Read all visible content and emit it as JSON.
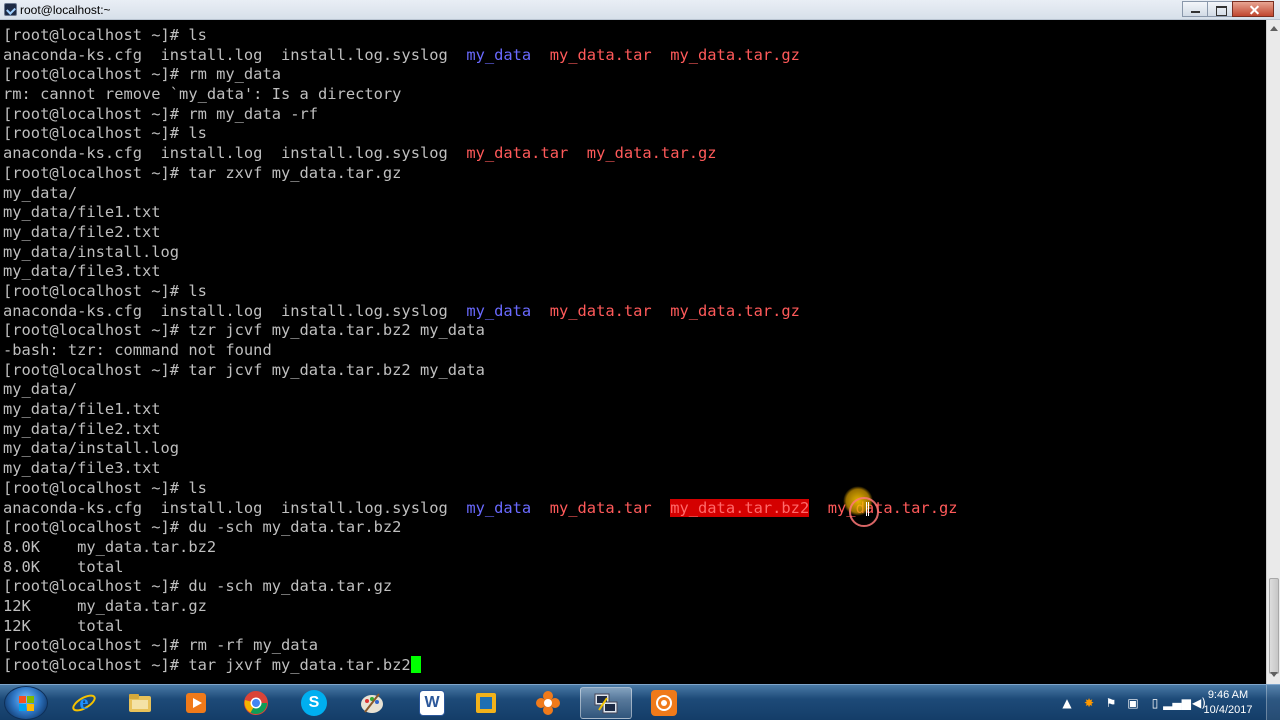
{
  "window": {
    "title": "root@localhost:~"
  },
  "terminal": {
    "lines": [
      [
        {
          "t": "[root@localhost ~]# ls",
          "c": ""
        }
      ],
      [
        {
          "t": "anaconda-ks.cfg  install.log  install.log.syslog  ",
          "c": ""
        },
        {
          "t": "my_data",
          "c": "dir"
        },
        {
          "t": "  ",
          "c": ""
        },
        {
          "t": "my_data.tar",
          "c": "arc"
        },
        {
          "t": "  ",
          "c": ""
        },
        {
          "t": "my_data.tar.gz",
          "c": "arc"
        }
      ],
      [
        {
          "t": "[root@localhost ~]# rm my_data",
          "c": ""
        }
      ],
      [
        {
          "t": "rm: cannot remove `my_data': Is a directory",
          "c": ""
        }
      ],
      [
        {
          "t": "[root@localhost ~]# rm my_data -rf",
          "c": ""
        }
      ],
      [
        {
          "t": "[root@localhost ~]# ls",
          "c": ""
        }
      ],
      [
        {
          "t": "anaconda-ks.cfg  install.log  install.log.syslog  ",
          "c": ""
        },
        {
          "t": "my_data.tar",
          "c": "arc"
        },
        {
          "t": "  ",
          "c": ""
        },
        {
          "t": "my_data.tar.gz",
          "c": "arc"
        }
      ],
      [
        {
          "t": "[root@localhost ~]# tar zxvf my_data.tar.gz",
          "c": ""
        }
      ],
      [
        {
          "t": "my_data/",
          "c": ""
        }
      ],
      [
        {
          "t": "my_data/file1.txt",
          "c": ""
        }
      ],
      [
        {
          "t": "my_data/file2.txt",
          "c": ""
        }
      ],
      [
        {
          "t": "my_data/install.log",
          "c": ""
        }
      ],
      [
        {
          "t": "my_data/file3.txt",
          "c": ""
        }
      ],
      [
        {
          "t": "[root@localhost ~]# ls",
          "c": ""
        }
      ],
      [
        {
          "t": "anaconda-ks.cfg  install.log  install.log.syslog  ",
          "c": ""
        },
        {
          "t": "my_data",
          "c": "dir"
        },
        {
          "t": "  ",
          "c": ""
        },
        {
          "t": "my_data.tar",
          "c": "arc"
        },
        {
          "t": "  ",
          "c": ""
        },
        {
          "t": "my_data.tar.gz",
          "c": "arc"
        }
      ],
      [
        {
          "t": "[root@localhost ~]# tzr jcvf my_data.tar.bz2 my_data",
          "c": ""
        }
      ],
      [
        {
          "t": "-bash: tzr: command not found",
          "c": ""
        }
      ],
      [
        {
          "t": "[root@localhost ~]# tar jcvf my_data.tar.bz2 my_data",
          "c": ""
        }
      ],
      [
        {
          "t": "my_data/",
          "c": ""
        }
      ],
      [
        {
          "t": "my_data/file1.txt",
          "c": ""
        }
      ],
      [
        {
          "t": "my_data/file2.txt",
          "c": ""
        }
      ],
      [
        {
          "t": "my_data/install.log",
          "c": ""
        }
      ],
      [
        {
          "t": "my_data/file3.txt",
          "c": ""
        }
      ],
      [
        {
          "t": "[root@localhost ~]# ls",
          "c": ""
        }
      ],
      [
        {
          "t": "anaconda-ks.cfg  install.log  install.log.syslog  ",
          "c": ""
        },
        {
          "t": "my_data",
          "c": "dir"
        },
        {
          "t": "  ",
          "c": ""
        },
        {
          "t": "my_data.tar",
          "c": "arc"
        },
        {
          "t": "  ",
          "c": ""
        },
        {
          "t": "my_data.tar.bz2",
          "c": "hl"
        },
        {
          "t": "  ",
          "c": ""
        },
        {
          "t": "my_data.tar.gz",
          "c": "arc"
        }
      ],
      [
        {
          "t": "[root@localhost ~]# du -sch my_data.tar.bz2",
          "c": ""
        }
      ],
      [
        {
          "t": "8.0K    my_data.tar.bz2",
          "c": ""
        }
      ],
      [
        {
          "t": "8.0K    total",
          "c": ""
        }
      ],
      [
        {
          "t": "[root@localhost ~]# du -sch my_data.tar.gz",
          "c": ""
        }
      ],
      [
        {
          "t": "12K     my_data.tar.gz",
          "c": ""
        }
      ],
      [
        {
          "t": "12K     total",
          "c": ""
        }
      ],
      [
        {
          "t": "[root@localhost ~]# rm -rf my_data",
          "c": ""
        }
      ],
      [
        {
          "t": "[root@localhost ~]# tar jxvf my_data.tar.bz2",
          "c": ""
        }
      ]
    ]
  },
  "colors": {
    "terminal_bg": "#000000",
    "text": "#bfbfbf",
    "directory": "#6a6aff",
    "archive": "#ff5a5a",
    "highlight_bg": "#d40000",
    "cursor": "#00ff00"
  },
  "taskbar": {
    "items": [
      {
        "name": "internet-explorer",
        "icon": "ie-icon"
      },
      {
        "name": "file-explorer",
        "icon": "folder-icon"
      },
      {
        "name": "media-player",
        "icon": "media-player-icon"
      },
      {
        "name": "chrome",
        "icon": "chrome-icon"
      },
      {
        "name": "skype",
        "icon": "skype-icon",
        "glyph": "S"
      },
      {
        "name": "paint",
        "icon": "paint-icon"
      },
      {
        "name": "word",
        "icon": "word-icon",
        "glyph": "W"
      },
      {
        "name": "virtual-machine",
        "icon": "vm-icon"
      },
      {
        "name": "settings-app",
        "icon": "flower-icon"
      },
      {
        "name": "putty",
        "icon": "putty-icon",
        "active": true
      },
      {
        "name": "recorder",
        "icon": "recorder-icon"
      }
    ],
    "clock": {
      "time": "9:46 AM",
      "date": "10/4/2017"
    }
  }
}
